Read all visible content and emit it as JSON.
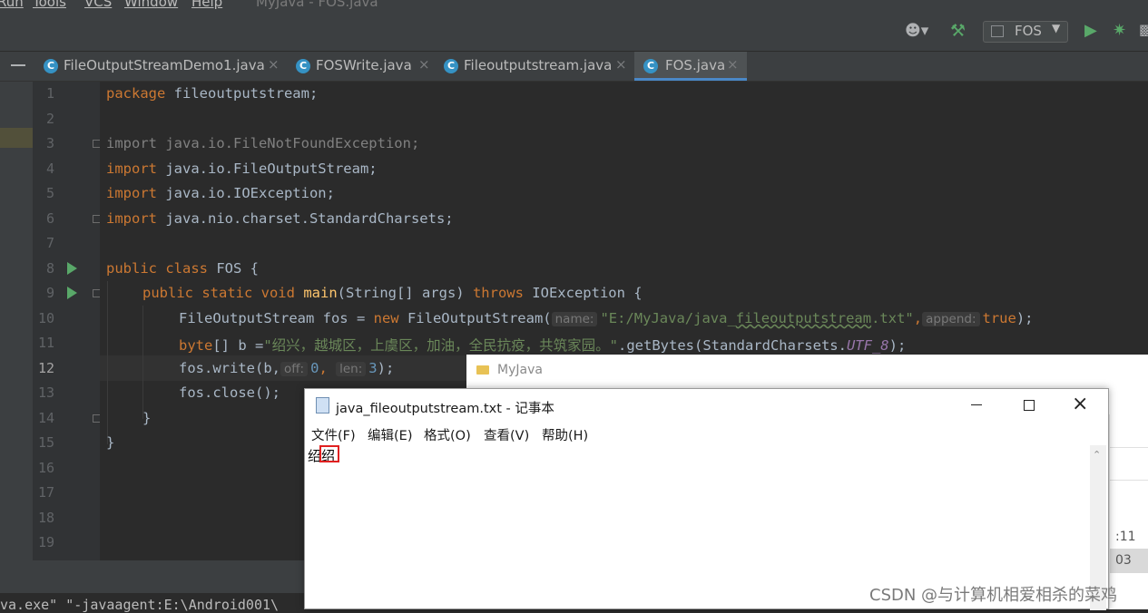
{
  "menubar": {
    "items": [
      "Run",
      "Tools",
      "VCS",
      "Window",
      "Help"
    ],
    "title": "MyJava - FOS.java"
  },
  "toolbar": {
    "icons": [
      "user-icon",
      "hammer-icon",
      "run-icon",
      "debug-icon",
      "coverage-icon"
    ],
    "run_config": "FOS"
  },
  "tabs": [
    {
      "label": "FileOutputStreamDemo1.java",
      "active": false
    },
    {
      "label": "FOSWrite.java",
      "active": false
    },
    {
      "label": "Fileoutputstream.java",
      "active": false
    },
    {
      "label": "FOS.java",
      "active": true
    }
  ],
  "editor": {
    "line_numbers": [
      "1",
      "2",
      "3",
      "4",
      "5",
      "6",
      "7",
      "8",
      "9",
      "10",
      "11",
      "12",
      "13",
      "14",
      "15",
      "16",
      "17",
      "18",
      "19"
    ],
    "current_line": "12",
    "l1_kw": "package",
    "l1_rest": " fileoutputstream;",
    "l3": "import java.io.FileNotFoundException;",
    "import_kw": "import",
    "l4_rest": " java.io.FileOutputStream;",
    "l5_rest": " java.io.IOException;",
    "l6_rest": " java.nio.charset.StandardCharsets;",
    "l8_kw": "public class",
    "l8_rest": " FOS {",
    "l9_kw": "public static void",
    "l9_fn": "main",
    "l9_mid": "(String[] args) ",
    "l9_throws": "throws",
    "l9_rest": " IOException {",
    "l10_a": "FileOutputStream fos = ",
    "l10_new": "new",
    "l10_b": " FileOutputStream(",
    "l10_hint1": "name:",
    "l10_str1": "\"E:/MyJava/java_",
    "l10_str2": "fileoutputstream",
    "l10_str3": ".txt\"",
    "l10_comma": ",",
    "l10_hint2": "append:",
    "l10_true": "true",
    "l10_end": ");",
    "l11_kw": "byte",
    "l11_a": "[] b =",
    "l11_str": "\"绍兴，越城区，上虞区，加油，全民抗疫，共筑家园。\"",
    "l11_b": ".getBytes(StandardCharsets.",
    "l11_const": "UTF_8",
    "l11_end": ");",
    "l12_a": "fos.write(b,",
    "l12_hint1": "off:",
    "l12_n1": "0",
    "l12_comma": ",",
    "l12_hint2": "len:",
    "l12_n2": "3",
    "l12_end": ");",
    "l13": "fos.close();",
    "l14": "}",
    "l15": "}"
  },
  "console": {
    "line": "va.exe\" \"-javaagent:E:\\Android001\\"
  },
  "explorer": {
    "title": "MyJava",
    "partial_1": ":11",
    "partial_2": "03"
  },
  "notepad": {
    "title": "java_fileoutputstream.txt - 记事本",
    "menu": [
      "文件(F)",
      "编辑(E)",
      "格式(O)",
      "查看(V)",
      "帮助(H)"
    ],
    "content": "绍绍"
  },
  "watermark": "CSDN @与计算机相爱相杀的菜鸡"
}
